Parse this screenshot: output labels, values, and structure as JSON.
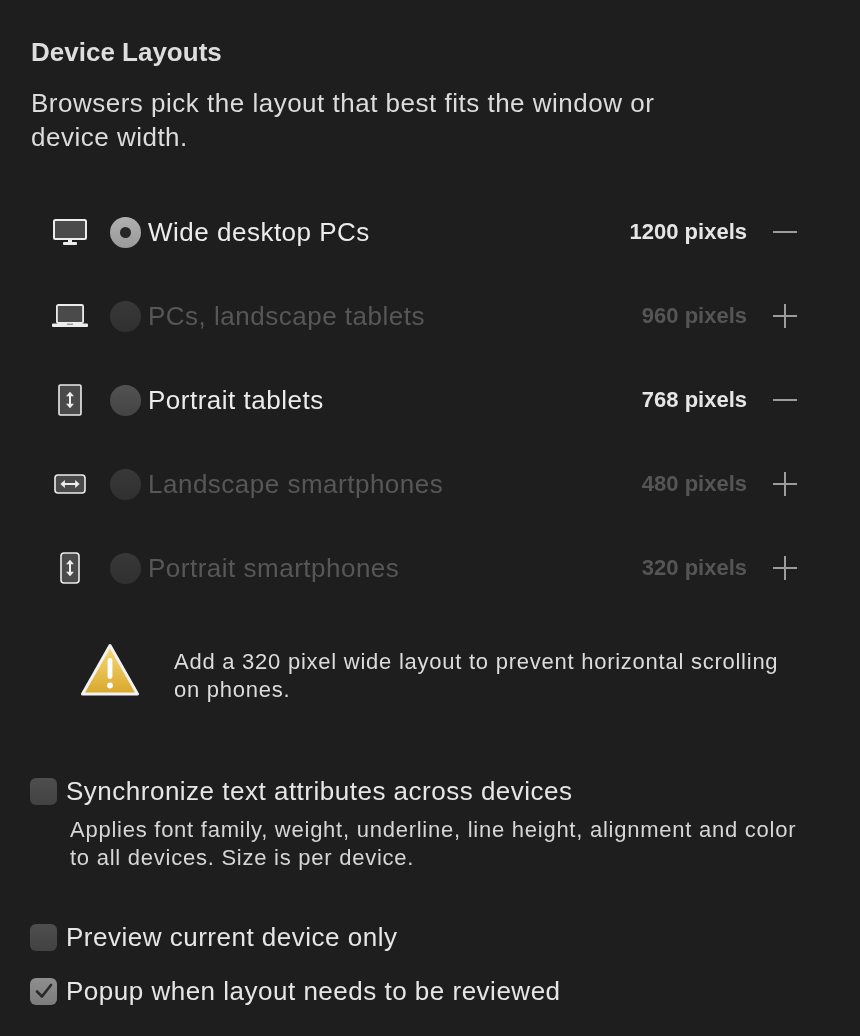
{
  "title": "Device Layouts",
  "description": "Browsers pick the layout that best fits the window or device width.",
  "layouts": [
    {
      "kind": "desktop",
      "label": "Wide desktop PCs",
      "width": "1200 pixels",
      "selected": true,
      "enabled": true
    },
    {
      "kind": "laptop",
      "label": "PCs, landscape tablets",
      "width": "960 pixels",
      "selected": false,
      "enabled": false
    },
    {
      "kind": "tablet",
      "label": "Portrait tablets",
      "width": "768 pixels",
      "selected": false,
      "enabled": true
    },
    {
      "kind": "phone-landscape",
      "label": "Landscape smartphones",
      "width": "480 pixels",
      "selected": false,
      "enabled": false
    },
    {
      "kind": "phone",
      "label": "Portrait smartphones",
      "width": "320 pixels",
      "selected": false,
      "enabled": false
    }
  ],
  "warning": {
    "text": "Add a 320 pixel wide layout to prevent horizontal scrolling on phones."
  },
  "options": [
    {
      "label": "Synchronize text attributes across devices",
      "checked": false,
      "description": "Applies font family, weight, underline, line height, alignment and color to all devices. Size is per device."
    },
    {
      "label": "Preview current device only",
      "checked": false
    },
    {
      "label": "Popup when layout needs to be reviewed",
      "checked": true
    }
  ]
}
